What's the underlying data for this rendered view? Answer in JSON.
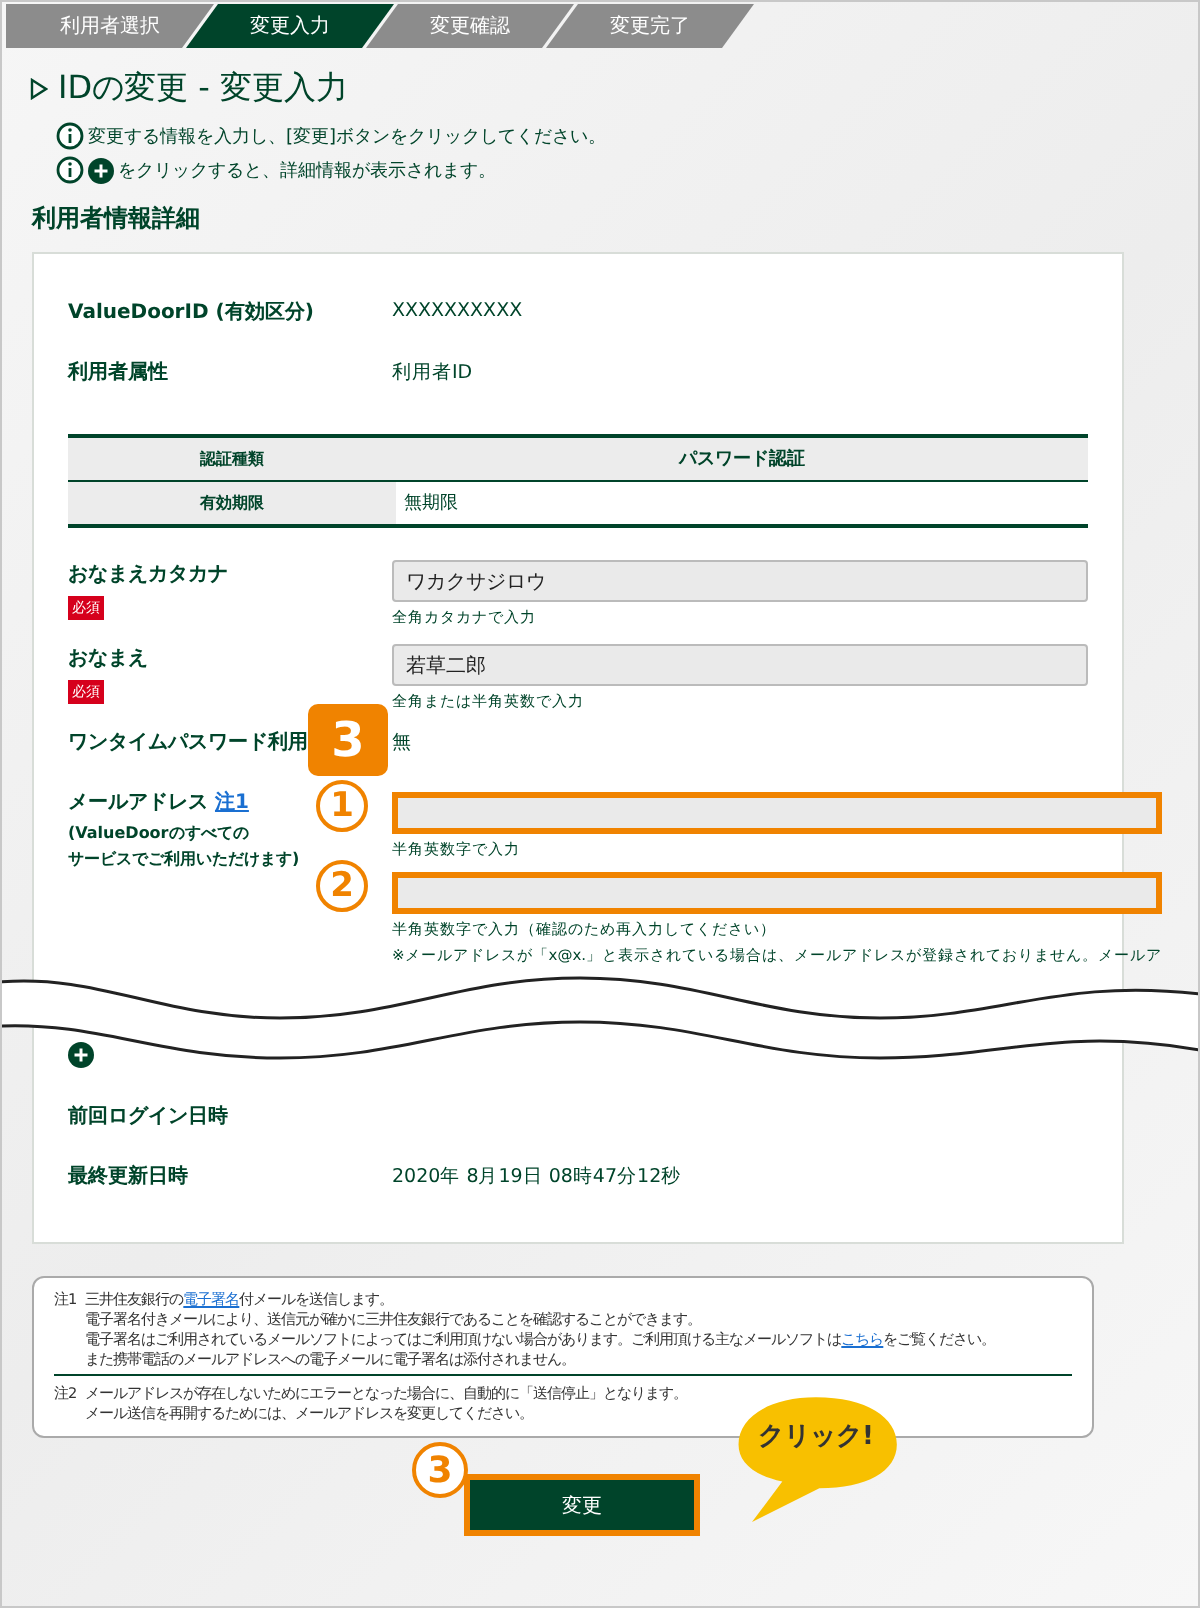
{
  "steps": [
    {
      "label": "利用者選択",
      "selected": false
    },
    {
      "label": "変更入力",
      "selected": true
    },
    {
      "label": "変更確認",
      "selected": false
    },
    {
      "label": "変更完了",
      "selected": false
    }
  ],
  "title": "IDの変更 - 変更入力",
  "info": [
    {
      "text": "変更する情報を入力し、[変更]ボタンをクリックしてください。",
      "plus": false
    },
    {
      "text": "をクリックすると、詳細情報が表示されます。",
      "plus": true
    }
  ],
  "section_heading": "利用者情報詳細",
  "rows": [
    {
      "kind": "text",
      "label": "ValueDoorID (有効区分)",
      "value": "XXXXXXXXXX"
    },
    {
      "kind": "text",
      "label": "利用者属性",
      "value": "利用者ID"
    },
    {
      "kind": "table",
      "cells": [
        {
          "head": "認証種類",
          "value": "パスワード認証",
          "header": true
        },
        {
          "head": "有効期限",
          "value": "無期限",
          "header": false
        }
      ]
    },
    {
      "kind": "input",
      "label": "おなまえカタカナ",
      "required": "必須",
      "value": "ワカクサジロウ",
      "hints": [
        "全角カタカナで入力"
      ]
    },
    {
      "kind": "input",
      "label": "おなまえ",
      "required": "必須",
      "value": "若草二郎",
      "hints": [
        "全角または半角英数で入力"
      ]
    },
    {
      "kind": "text",
      "label": "ワンタイムパスワード利用",
      "value": "無",
      "badge": "3"
    },
    {
      "kind": "email",
      "label": "メールアドレス",
      "note_link": "注1",
      "sublabel": [
        "(ValueDoorのすべての",
        "サービスでご利用いただけます)"
      ],
      "fields": [
        {
          "marker": "1",
          "highlighted": true,
          "hints": [
            "半角英数字で入力"
          ]
        },
        {
          "marker": "2",
          "highlighted": true,
          "hints": [
            "半角英数字で入力（確認のため再入力してください）",
            "※メールアドレスが「x@x.」と表示されている場合は、メールアドレスが登録されておりません。メールア"
          ]
        }
      ]
    },
    {
      "kind": "break"
    },
    {
      "kind": "expander"
    },
    {
      "kind": "text",
      "label": "前回ログイン日時"
    },
    {
      "kind": "text",
      "label": "最終更新日時",
      "value": "2020年 8月19日 08時47分12秒"
    }
  ],
  "notes": [
    {
      "label": "注1",
      "lines": [
        [
          {
            "text": "三井住友銀行の"
          },
          {
            "text": "電子署名",
            "link": true
          },
          {
            "text": "付メールを送信します。"
          }
        ],
        [
          {
            "text": "電子署名付きメールにより、送信元が確かに三井住友銀行であることを確認することができます。"
          }
        ],
        [
          {
            "text": "電子署名はご利用されているメールソフトによってはご利用頂けない場合があります。ご利用頂ける主なメールソフトは"
          },
          {
            "text": "こちら",
            "link": true
          },
          {
            "text": "をご覧ください。"
          }
        ],
        [
          {
            "text": "また携帯電話のメールアドレスへの電子メールに電子署名は添付されません。"
          }
        ]
      ]
    },
    {
      "label": "注2",
      "lines": [
        [
          {
            "text": "メールアドレスが存在しないためにエラーとなった場合に、自動的に「送信停止」となります。"
          }
        ],
        [
          {
            "text": "メール送信を再開するためには、メールアドレスを変更してください。"
          }
        ]
      ]
    }
  ],
  "button": {
    "label": "変更",
    "highlighted": true,
    "marker": "3"
  },
  "callout": "クリック!"
}
